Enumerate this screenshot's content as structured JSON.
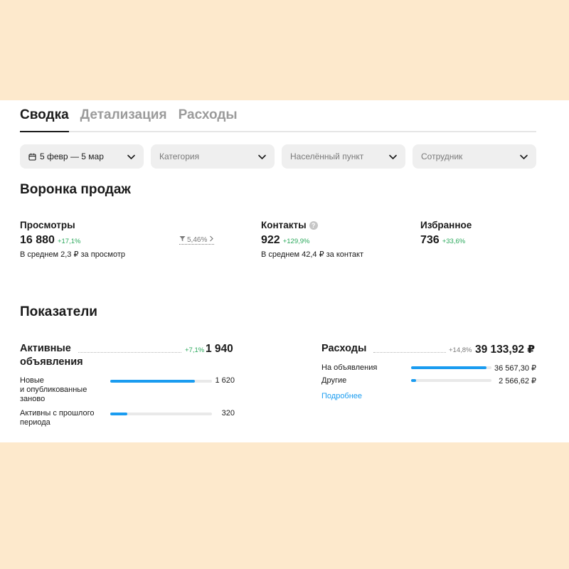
{
  "tabs": [
    {
      "label": "Сводка",
      "active": true
    },
    {
      "label": "Детализация",
      "active": false
    },
    {
      "label": "Расходы",
      "active": false
    }
  ],
  "filters": {
    "date": "5 февр — 5 мар",
    "category": "Категория",
    "locality": "Населённый пункт",
    "employee": "Сотрудник"
  },
  "funnel": {
    "title": "Воронка продаж",
    "views": {
      "label": "Просмотры",
      "value": "16 880",
      "change": "+17,1%",
      "sub": "В среднем 2,3 ₽ за просмотр"
    },
    "conversion": "5,46%",
    "contacts": {
      "label": "Контакты",
      "value": "922",
      "change": "+129,9%",
      "sub": "В среднем 42,4 ₽ за контакт"
    },
    "favorites": {
      "label": "Избранное",
      "value": "736",
      "change": "+33,6%"
    }
  },
  "indicators": {
    "title": "Показатели",
    "active": {
      "title_line1": "Активные",
      "title_line2": "объявления",
      "change": "+7,1%",
      "value": "1 940",
      "rows": [
        {
          "label1": "Новые",
          "label2": "и опубликованные",
          "label3": "заново",
          "value": "1 620",
          "fraction": 0.835
        },
        {
          "label1": "Активны с прошлого",
          "label2": "периода",
          "value": "320",
          "fraction": 0.165
        }
      ]
    },
    "expenses": {
      "title": "Расходы",
      "change": "+14,8%",
      "value": "39 133,92 ₽",
      "rows": [
        {
          "label": "На объявления",
          "value": "36 567,30 ₽",
          "fraction": 0.934
        },
        {
          "label": "Другие",
          "value": "2 566,62 ₽",
          "fraction": 0.066
        }
      ],
      "more": "Подробнее"
    }
  },
  "colors": {
    "accent": "#1a9cf0",
    "positive": "#2aa85b",
    "background": "#fde9cc"
  }
}
